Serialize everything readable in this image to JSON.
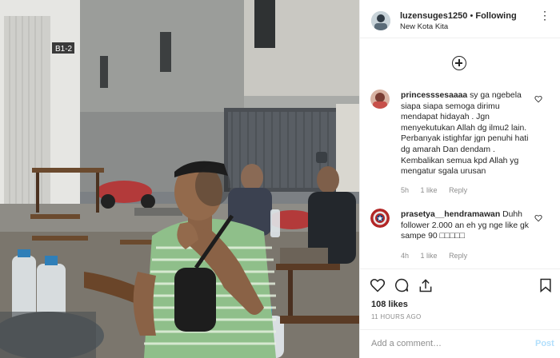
{
  "header": {
    "username": "luzensuges1250",
    "separator": "•",
    "follow_status": "Following",
    "location": "New Kota Kita",
    "more_glyph": "⋮"
  },
  "photo": {
    "sign_text": "B1-2"
  },
  "comments": [
    {
      "username": "princesssesaaaa",
      "text": "sy ga ngebela siapa siapa semoga dirimu mendapat hidayah . Jgn menyekutukan Allah dg ilmu2 lain. Perbanyak istighfar jgn penuhi hati dg amarah Dan dendam . Kembalikan semua kpd Allah yg mengatur sgala urusan",
      "age": "5h",
      "likes": "1 like",
      "reply": "Reply"
    },
    {
      "username": "prasetya__hendramawan",
      "text": "Duhh follower 2.000 an eh yg nge like gk sampe 90 □□□□□",
      "age": "4h",
      "likes": "1 like",
      "reply": "Reply"
    }
  ],
  "actions": {
    "likes": "108 likes",
    "time": "11 HOURS AGO"
  },
  "add_comment": {
    "placeholder": "Add a comment…",
    "post_label": "Post"
  },
  "colors": {
    "text": "#262626",
    "muted": "#8e8e8e",
    "border": "#efefef",
    "post_disabled": "#b2dffc",
    "shirt": "#8fbf8a"
  },
  "icons": [
    "more-options-icon",
    "load-more-comments-icon",
    "heart-icon",
    "comment-icon",
    "share-icon",
    "bookmark-icon"
  ]
}
